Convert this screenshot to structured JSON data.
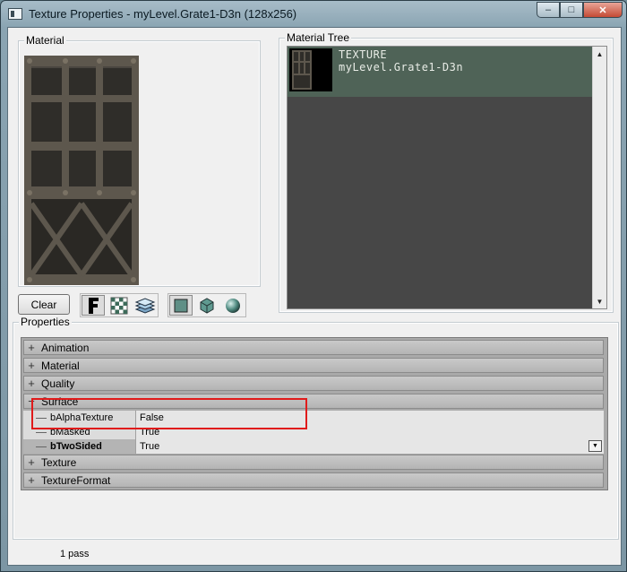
{
  "window": {
    "title": "Texture Properties - myLevel.Grate1-D3n (128x256)",
    "controls": {
      "minimize": "–",
      "maximize": "□",
      "close": "✕"
    }
  },
  "material": {
    "group_label": "Material"
  },
  "material_tree": {
    "group_label": "Material Tree",
    "items": [
      {
        "type": "TEXTURE",
        "name": "myLevel.Grate1-D3n"
      }
    ]
  },
  "toolbar": {
    "clear_label": "Clear",
    "group1": [
      {
        "icon": "bold-f-icon",
        "active": true
      },
      {
        "icon": "checker-alpha-icon",
        "active": false
      },
      {
        "icon": "layers-icon",
        "active": false
      }
    ],
    "group2": [
      {
        "icon": "plane-icon",
        "active": true
      },
      {
        "icon": "cube-icon",
        "active": false
      },
      {
        "icon": "sphere-icon",
        "active": false
      }
    ]
  },
  "properties": {
    "group_label": "Properties",
    "categories": [
      {
        "label": "Animation",
        "expander": "+"
      },
      {
        "label": "Material",
        "expander": "+"
      },
      {
        "label": "Quality",
        "expander": "+"
      },
      {
        "label": "Surface",
        "expander": "−"
      },
      {
        "label": "Texture",
        "expander": "+"
      },
      {
        "label": "TextureFormat",
        "expander": "+"
      }
    ],
    "surface_props": [
      {
        "name": "bAlphaTexture",
        "value": "False"
      },
      {
        "name": "bMasked",
        "value": "True"
      },
      {
        "name": "bTwoSided",
        "value": "True"
      }
    ],
    "dropdown_glyph": "▼"
  },
  "status": {
    "passes": "1 pass"
  },
  "colors": {
    "highlight": "#e01b1b",
    "tree_row": "#4f6357",
    "tree_bg": "#474747"
  }
}
